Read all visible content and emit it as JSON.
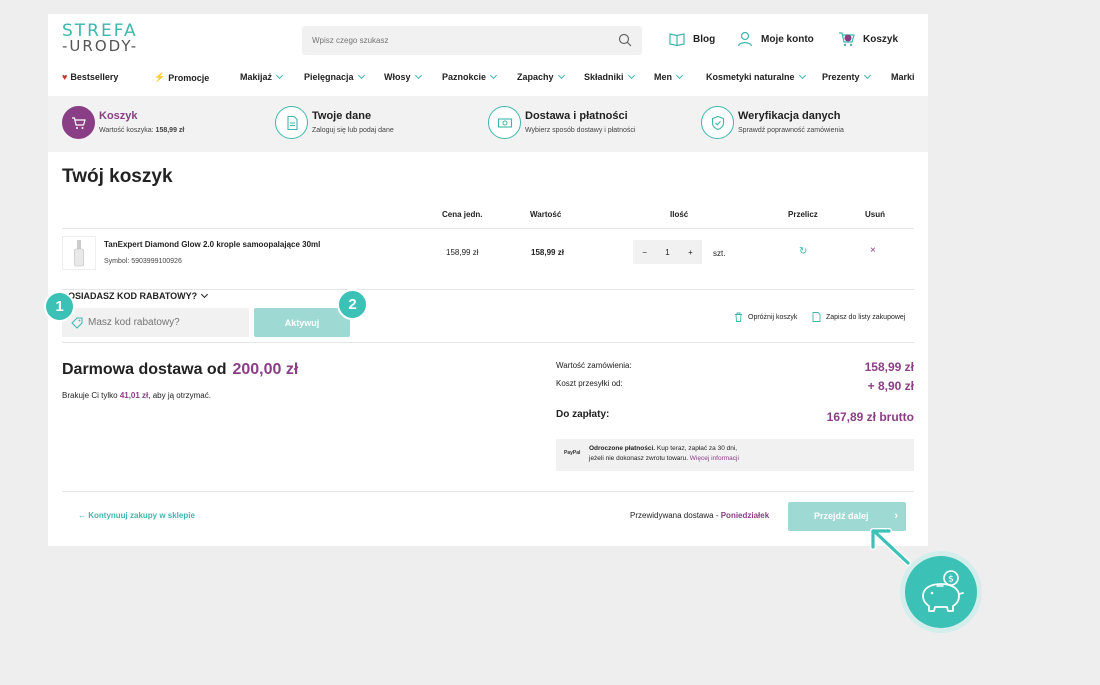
{
  "brand": {
    "line1": "STREFA",
    "line2": "-URODY-"
  },
  "search": {
    "placeholder": "Wpisz czego szukasz"
  },
  "header_links": {
    "blog": "Blog",
    "account": "Moje konto",
    "cart": "Koszyk"
  },
  "nav": [
    "Bestsellery",
    "Promocje",
    "Makijaż",
    "Pielęgnacja",
    "Włosy",
    "Paznokcie",
    "Zapachy",
    "Składniki",
    "Men",
    "Kosmetyki naturalne",
    "Prezenty",
    "Marki"
  ],
  "steps": [
    {
      "title": "Koszyk",
      "sub_label": "Wartość koszyka:",
      "sub_value": "158,99 zł"
    },
    {
      "title": "Twoje dane",
      "sub": "Zaloguj się lub podaj dane"
    },
    {
      "title": "Dostawa i płatności",
      "sub": "Wybierz sposób dostawy i płatności"
    },
    {
      "title": "Weryfikacja danych",
      "sub": "Sprawdź poprawność zamówienia"
    }
  ],
  "cart": {
    "title": "Twój koszyk",
    "headers": {
      "price": "Cena jedn.",
      "value": "Wartość",
      "qty": "Ilość",
      "recalc": "Przelicz",
      "remove": "Usuń"
    },
    "item": {
      "name": "TanExpert Diamond Glow 2.0 krople samoopalające 30ml",
      "symbol": "Symbol: 5903999100926",
      "price": "158,99 zł",
      "value": "158,99 zł",
      "qty": "1",
      "minus": "−",
      "plus": "+",
      "unit": "szt.",
      "recalc_icon": "↻",
      "remove_icon": "×"
    }
  },
  "coupon": {
    "label": "POSIADASZ KOD RABATOWY?",
    "placeholder": "Masz kod rabatowy?",
    "button": "Aktywuj",
    "badge1": "1",
    "badge2": "2"
  },
  "actions": {
    "empty": "Opróżnij koszyk",
    "save": "Zapisz do listy zakupowej"
  },
  "shipping": {
    "free_label": "Darmowa dostawa od",
    "free_amount": "200,00 zł",
    "missing_pre": "Brakuje Ci tylko",
    "missing_amount": "41,01 zł",
    "missing_post": ", aby ją otrzymać."
  },
  "summary": {
    "order_label": "Wartość zamówienia:",
    "order_value": "158,99 zł",
    "ship_label": "Koszt przesyłki od:",
    "ship_value": "+ 8,90 zł",
    "total_label": "Do zapłaty:",
    "total_value": "167,89 zł brutto"
  },
  "paypal": {
    "icon_text": "PayPal",
    "bold": "Odroczone płatności.",
    "line1_rest": " Kup teraz, zapłać za 30 dni,",
    "line2": "jeżeli nie dokonasz zwrotu towaru.",
    "link": " Więcej informacji"
  },
  "footer": {
    "back": "← Kontynuuj zakupy w sklepie",
    "delivery_label": "Przewidywana dostawa - ",
    "delivery_day": "Poniedziałek",
    "next": "Przejdź dalej",
    "next_arrow": "›"
  },
  "colors": {
    "accent": "#3fb6ad",
    "brand": "#8a3e86",
    "button_light": "#9fd9d3"
  }
}
